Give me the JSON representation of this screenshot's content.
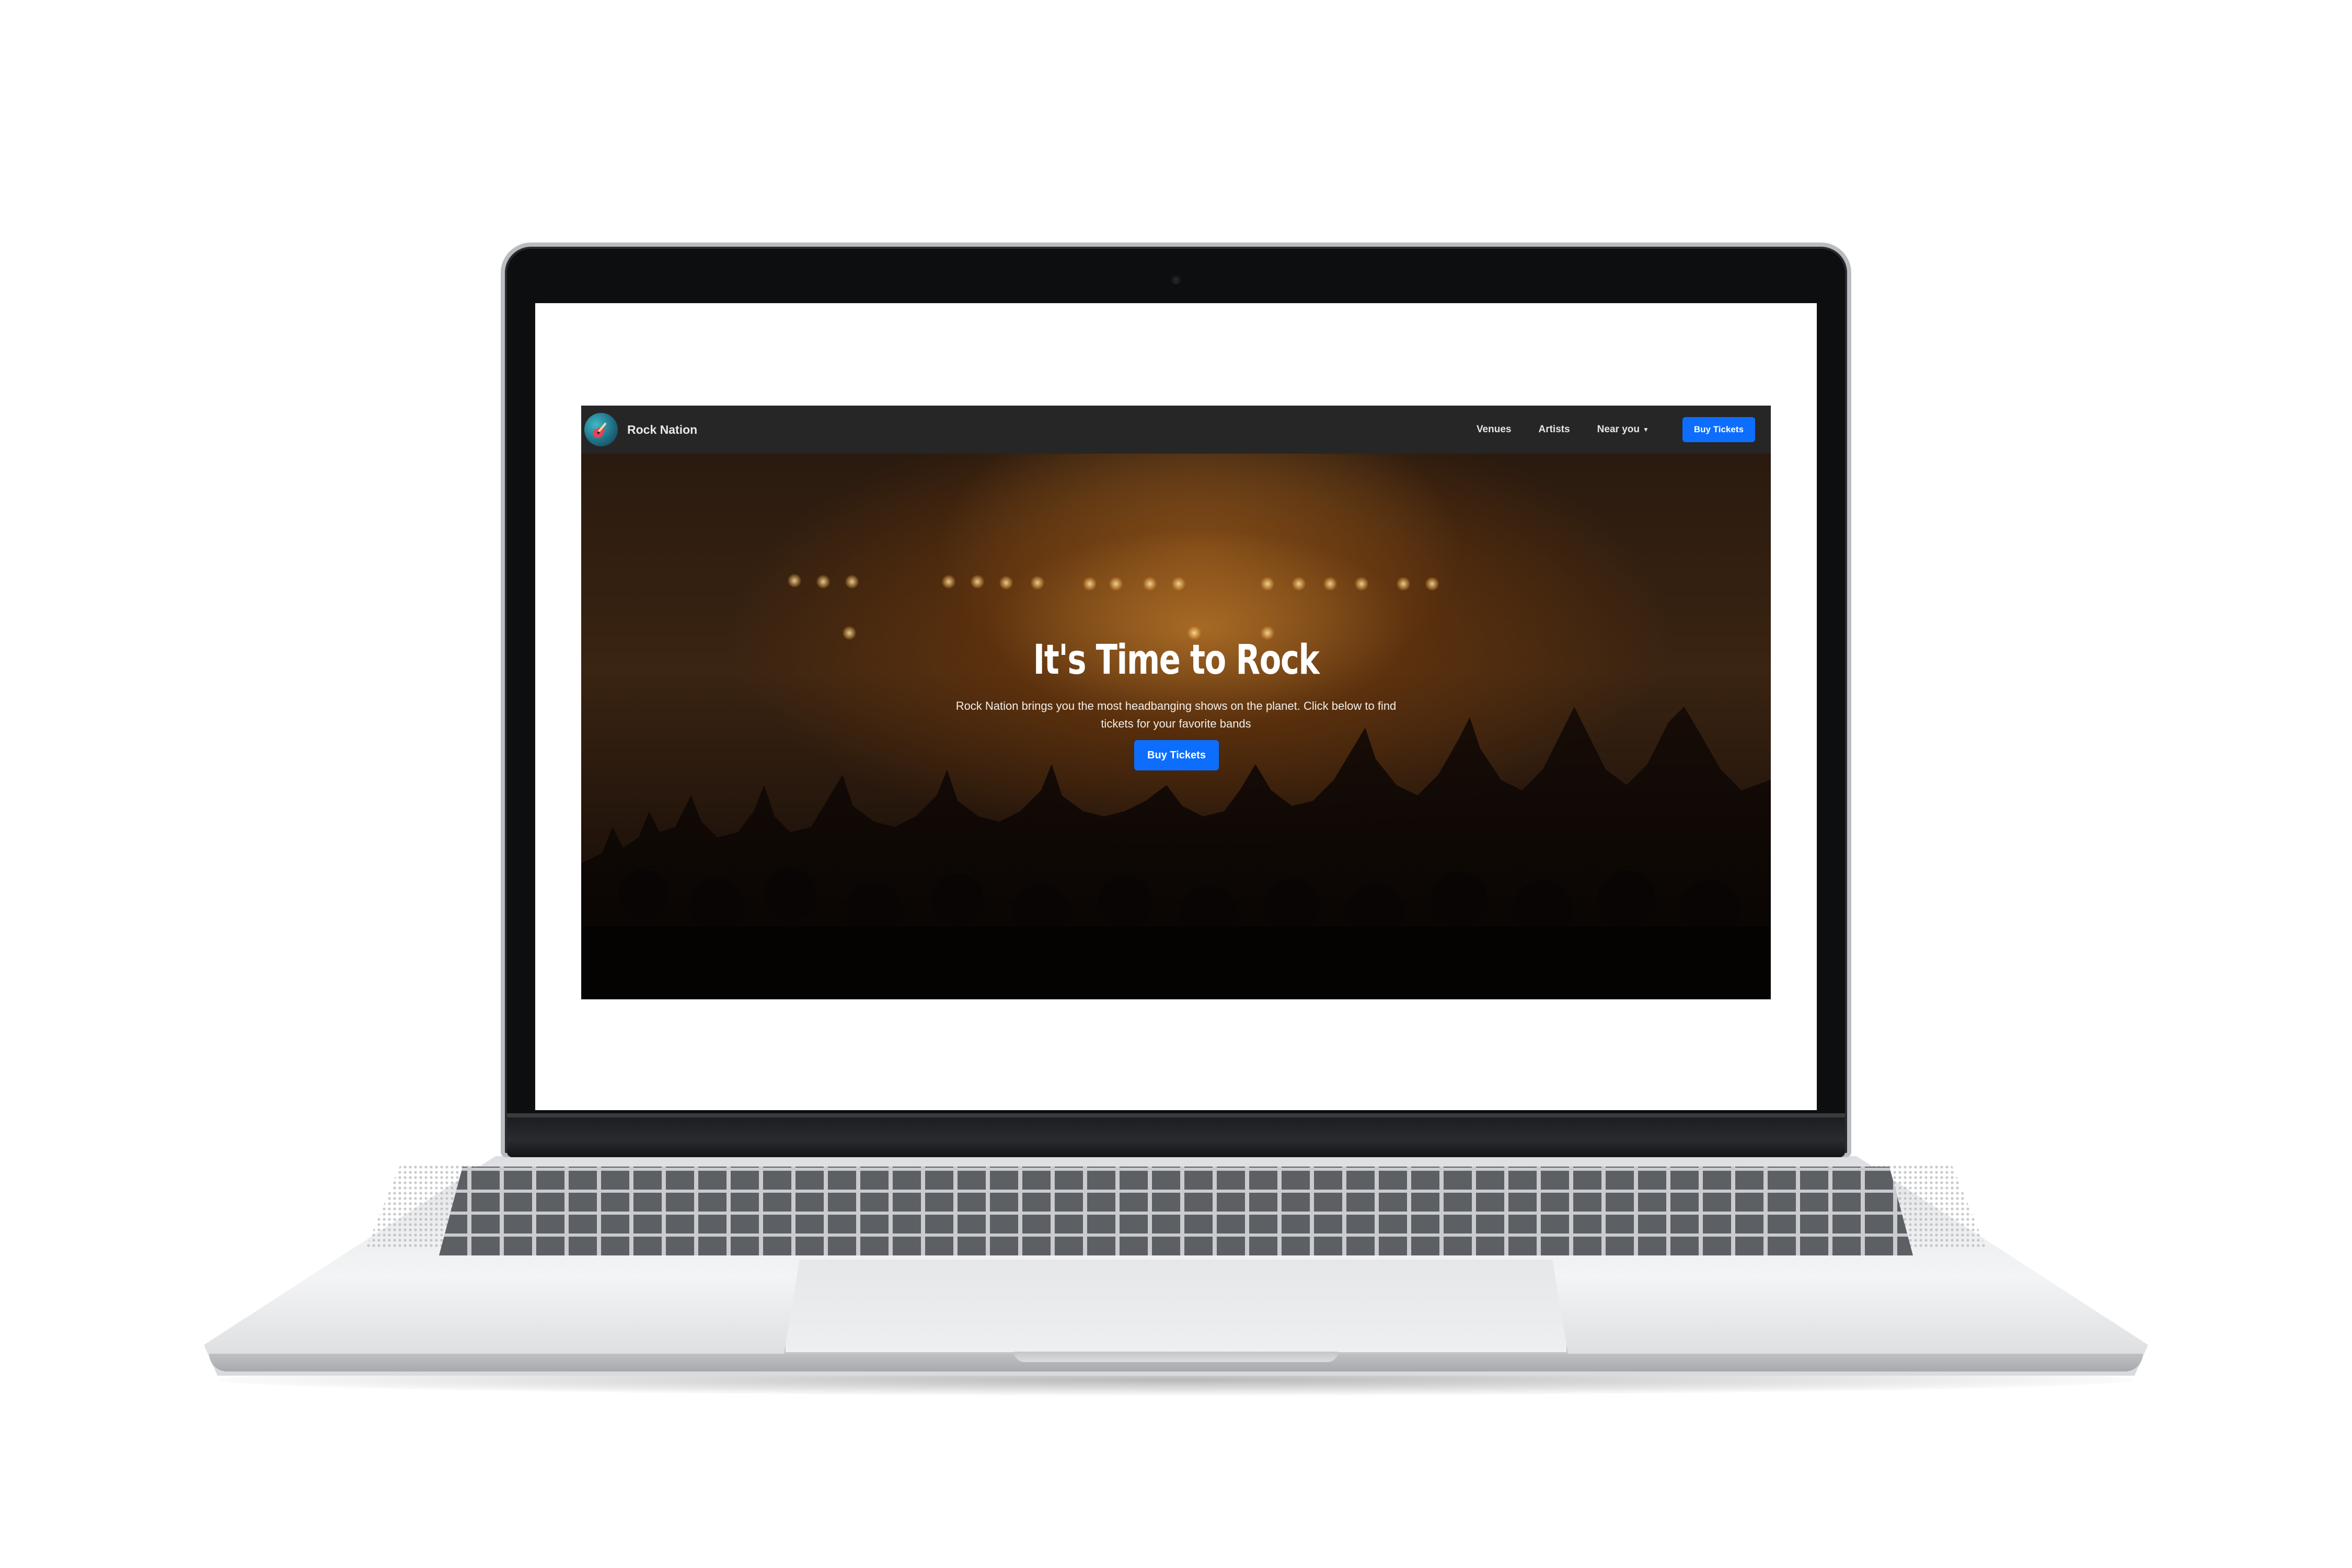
{
  "navbar": {
    "brand_name": "Rock Nation",
    "brand_icon": "guitar-icon",
    "links": [
      "Venues",
      "Artists"
    ],
    "dropdown_label": "Near you",
    "cta_label": "Buy Tickets"
  },
  "hero": {
    "title": "It's Time to Rock",
    "subtitle": "Rock Nation brings you the most headbanging shows on the planet. Click below to find tickets for your favorite bands",
    "cta_label": "Buy Tickets"
  },
  "colors": {
    "navbar_bg": "#262626",
    "primary_button": "#0d6efd",
    "hero_text": "#ffffff"
  }
}
